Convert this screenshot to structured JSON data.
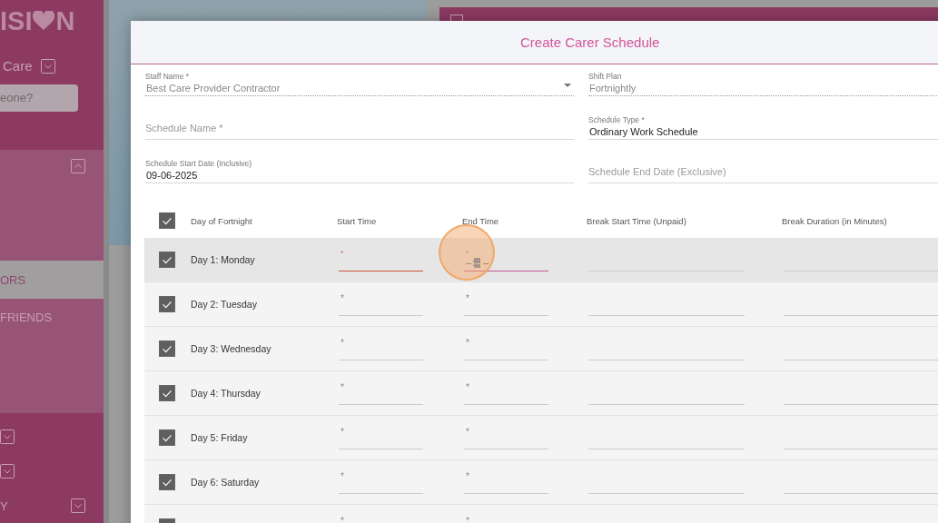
{
  "sidebar": {
    "logo_start": "ISI",
    "logo_end": "N",
    "org": "Care",
    "search_placeholder": "eone?",
    "sections": [
      {
        "kind": "group",
        "expanded": true
      },
      {
        "kind": "item",
        "label": "ORS",
        "selected": true
      },
      {
        "kind": "item",
        "label": "FRIENDS",
        "selected": false
      },
      {
        "kind": "group",
        "expanded": false
      },
      {
        "kind": "group",
        "expanded": false
      },
      {
        "kind": "group",
        "label": "Y",
        "expanded": false
      }
    ]
  },
  "dialog": {
    "title": "Create Carer Schedule",
    "form_rows": [
      [
        {
          "label": "Staff Name *",
          "value": "Best Care Provider Contractor",
          "kind": "select",
          "readonly": true
        },
        {
          "label": "Shift Plan",
          "value": "Fortnightly",
          "kind": "text",
          "readonly": true
        }
      ],
      [
        {
          "placeholder": "Schedule Name *",
          "kind": "text",
          "readonly": false
        },
        {
          "label": "Schedule Type *",
          "value": "Ordinary Work Schedule",
          "kind": "text",
          "readonly": false
        }
      ],
      [
        {
          "label": "Schedule Start Date (Inclusive)",
          "value": "09-06-2025",
          "kind": "date",
          "readonly": false
        },
        {
          "placeholder": "Schedule End Date (Exclusive)",
          "kind": "date",
          "readonly": false
        }
      ]
    ],
    "table": {
      "all_checked": true,
      "columns": [
        "Day of Fortnight",
        "Start Time",
        "End Time",
        "Break Start Time (Unpaid)",
        "Break Duration (in Minutes)"
      ],
      "rows": [
        {
          "checked": true,
          "day": "Day 1: Monday",
          "highlighted": true,
          "start": {
            "required": "*",
            "error": true,
            "focused": false
          },
          "end": {
            "required": "*",
            "error": false,
            "focused": true,
            "segments": [
              {
                "text": "--:",
                "selected": false
              },
              {
                "text": "--",
                "selected": true
              },
              {
                "text": " --",
                "selected": false
              }
            ]
          }
        },
        {
          "checked": true,
          "day": "Day 2: Tuesday",
          "highlighted": false,
          "start": {
            "required": "*",
            "error": false,
            "focused": false
          },
          "end": {
            "required": "*",
            "error": false,
            "focused": false
          }
        },
        {
          "checked": true,
          "day": "Day 3: Wednesday",
          "highlighted": false,
          "start": {
            "required": "*",
            "error": false,
            "focused": false
          },
          "end": {
            "required": "*",
            "error": false,
            "focused": false
          }
        },
        {
          "checked": true,
          "day": "Day 4: Thursday",
          "highlighted": false,
          "start": {
            "required": "*",
            "error": false,
            "focused": false
          },
          "end": {
            "required": "*",
            "error": false,
            "focused": false
          }
        },
        {
          "checked": true,
          "day": "Day 5: Friday",
          "highlighted": false,
          "start": {
            "required": "*",
            "error": false,
            "focused": false
          },
          "end": {
            "required": "*",
            "error": false,
            "focused": false
          }
        },
        {
          "checked": true,
          "day": "Day 6: Saturday",
          "highlighted": false,
          "start": {
            "required": "*",
            "error": false,
            "focused": false
          },
          "end": {
            "required": "*",
            "error": false,
            "focused": false
          }
        },
        {
          "checked": true,
          "highlighted": false,
          "start": {
            "required": "*",
            "error": false,
            "focused": false
          },
          "end": {
            "required": "*",
            "error": false,
            "focused": false
          }
        }
      ]
    }
  }
}
